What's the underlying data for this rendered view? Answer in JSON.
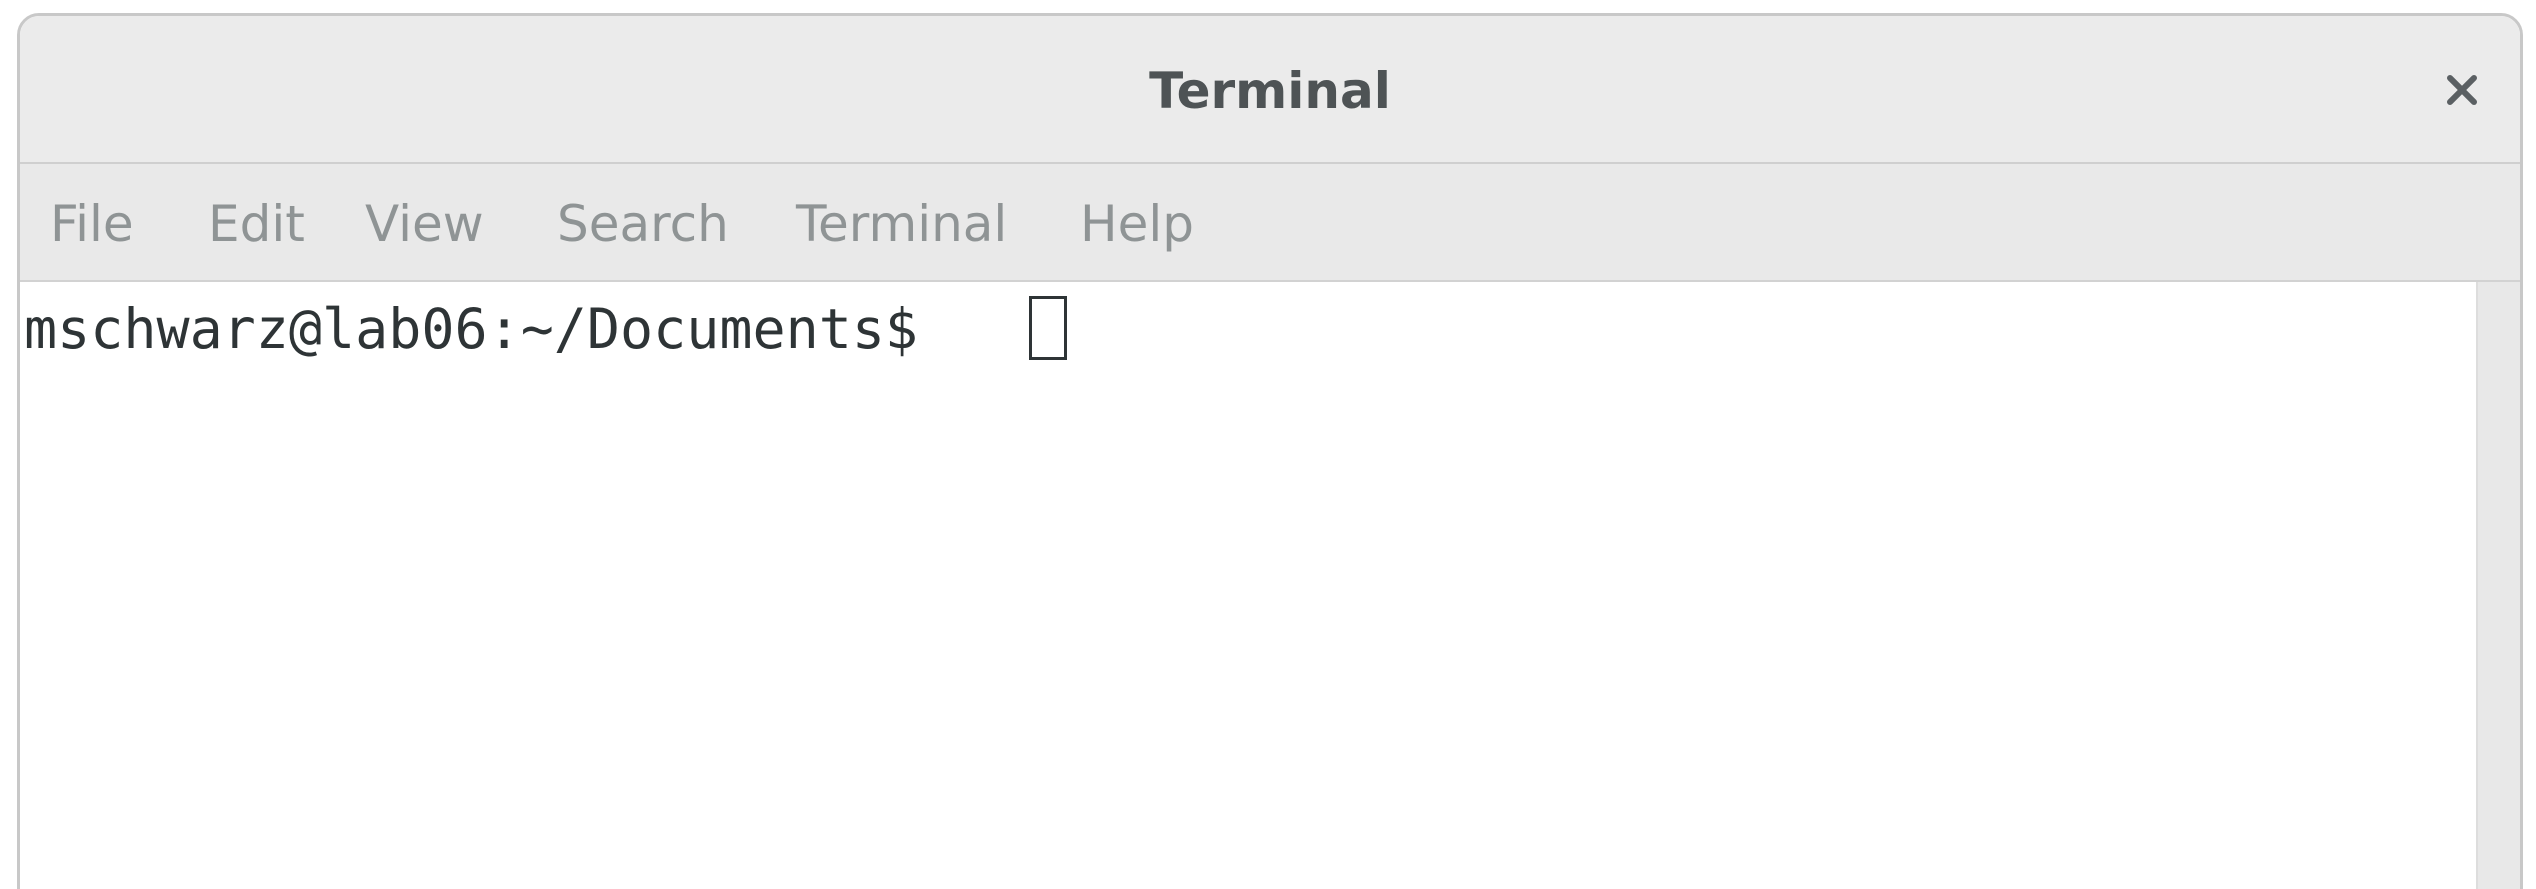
{
  "window": {
    "title": "Terminal"
  },
  "menu": {
    "items": [
      {
        "label": "File"
      },
      {
        "label": "Edit"
      },
      {
        "label": "View"
      },
      {
        "label": "Search"
      },
      {
        "label": "Terminal"
      },
      {
        "label": "Help"
      }
    ]
  },
  "terminal": {
    "prompt": "mschwarz@lab06:~/Documents$ "
  },
  "icons": {
    "close": "close-icon"
  },
  "colors": {
    "titlebar_bg": "#ebebeb",
    "menubar_bg": "#e9e9e9",
    "title_text": "#4e5355",
    "menu_text": "#8f9495",
    "terminal_text": "#2e3436",
    "terminal_bg": "#ffffff"
  }
}
